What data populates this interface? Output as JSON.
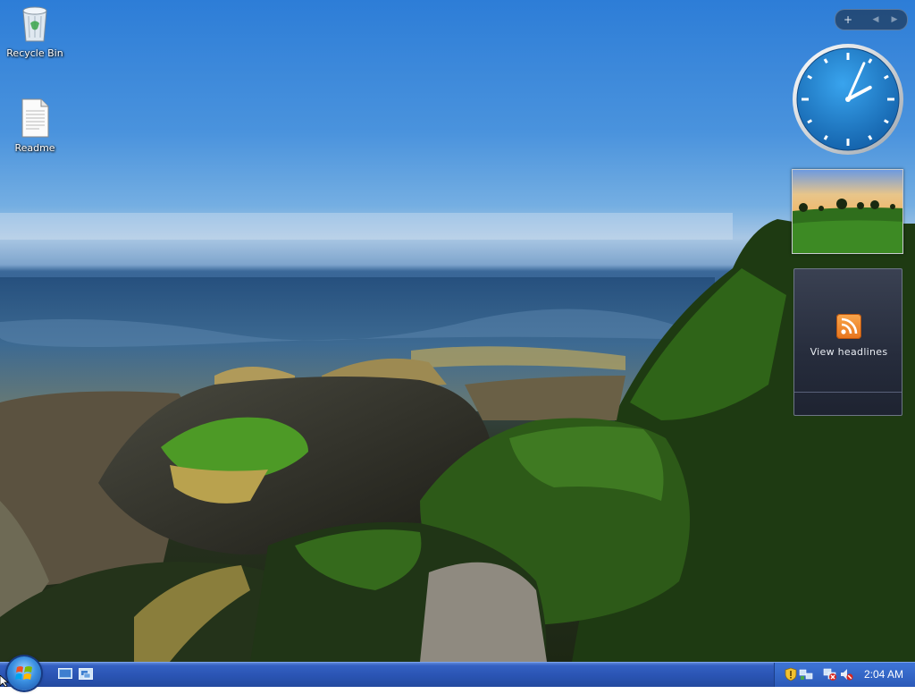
{
  "desktop": {
    "icons": [
      {
        "label": "Recycle Bin",
        "icon": "recycle-bin-icon"
      },
      {
        "label": "Readme",
        "icon": "text-document-icon"
      }
    ]
  },
  "sidebar": {
    "add_gadget": "+",
    "prev": "◀",
    "next": "▶"
  },
  "gadgets": {
    "clock": {
      "hour": 2,
      "minute": 4
    },
    "slideshow": {
      "subject": "landscape-photo"
    },
    "feeds": {
      "label": "View headlines",
      "icon": "rss-icon"
    }
  },
  "taskbar": {
    "quick_launch": [
      "show-desktop-icon",
      "switch-windows-icon"
    ],
    "tray_icons": [
      "security-shield-icon",
      "network-icon",
      "network-disconnected-icon",
      "volume-muted-icon"
    ],
    "time": "2:04 AM"
  },
  "colors": {
    "taskbar": "#2a54b3",
    "tray": "#2b5ab8",
    "clock_face": "#1e7fd0",
    "rss": "#f29330"
  }
}
